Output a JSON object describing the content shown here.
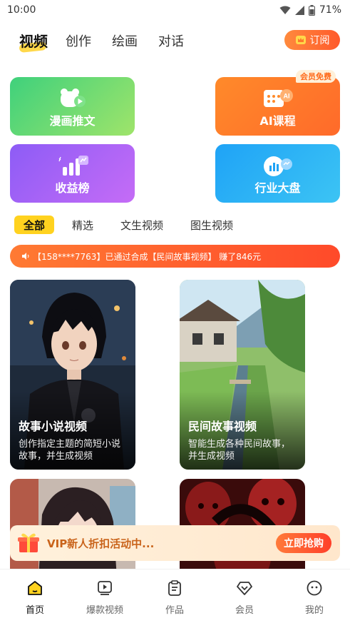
{
  "status_bar": {
    "time": "10:00",
    "battery": "71%",
    "icons": [
      "wifi-icon",
      "signal-icon",
      "battery-icon"
    ]
  },
  "top_tabs": {
    "items": [
      "视频",
      "创作",
      "绘画",
      "对话"
    ],
    "active": "视频"
  },
  "subscribe": {
    "label": "订阅",
    "icon": "crown-icon"
  },
  "features": [
    {
      "label": "漫画推文",
      "icon": "bear-play-icon"
    },
    {
      "label": "AI课程",
      "icon": "ai-calendar-icon",
      "badge": "会员免费"
    },
    {
      "label": "收益榜",
      "icon": "bar-chart-icon"
    },
    {
      "label": "行业大盘",
      "icon": "market-chart-icon"
    }
  ],
  "filters": {
    "items": [
      "全部",
      "精选",
      "文生视频",
      "图生视频"
    ],
    "active": "全部"
  },
  "ticker": {
    "text": "【158****7763】已通过合成【民间故事视频】 赚了846元",
    "icon": "speaker-icon"
  },
  "videos": [
    {
      "title": "故事小说视频",
      "desc": "创作指定主题的简短小说故事，并生成视频"
    },
    {
      "title": "民间故事视频",
      "desc": "智能生成各种民间故事，并生成视频"
    },
    {
      "title": "",
      "desc": ""
    },
    {
      "title": "",
      "desc": ""
    }
  ],
  "vip_banner": {
    "text": "VIP新人折扣活动中...",
    "button": "立即抢购",
    "icon": "gift-icon"
  },
  "bottom_nav": {
    "items": [
      {
        "label": "首页",
        "icon": "home-icon"
      },
      {
        "label": "爆款视频",
        "icon": "video-play-icon"
      },
      {
        "label": "作品",
        "icon": "clipboard-icon"
      },
      {
        "label": "会员",
        "icon": "diamond-icon"
      },
      {
        "label": "我的",
        "icon": "smile-icon"
      }
    ],
    "active": "首页"
  },
  "colors": {
    "accent": "#ffd21f",
    "orange": "#ff5a2c",
    "vip_text": "#c9631a"
  }
}
